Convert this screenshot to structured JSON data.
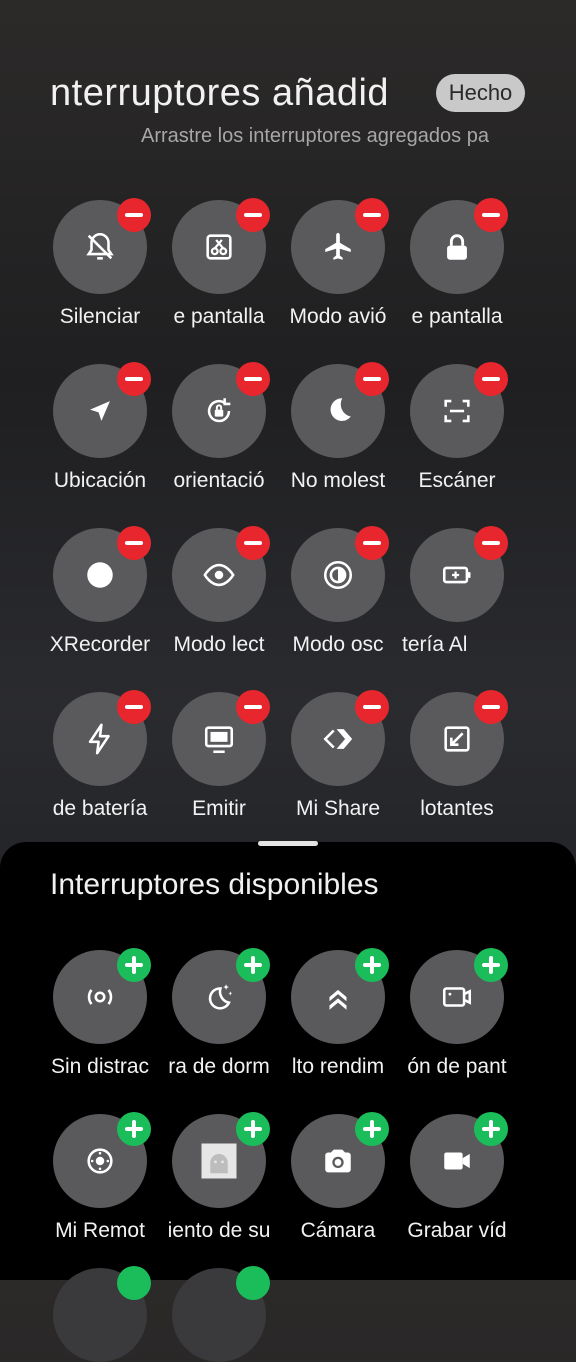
{
  "header": {
    "title": "nterruptores añadid",
    "subtitle": "Arrastre los interruptores agregados pa",
    "done_label": "Hecho"
  },
  "added_toggles": [
    {
      "label": "Silenciar",
      "icon": "bell-off-icon"
    },
    {
      "label": "e pantalla",
      "icon": "screenshot-scissors-icon"
    },
    {
      "label": "Modo avió",
      "icon": "airplane-icon"
    },
    {
      "label": "e pantalla",
      "icon": "lock-icon"
    },
    {
      "label": "Ubicación",
      "icon": "location-arrow-icon"
    },
    {
      "label": "orientació",
      "icon": "rotation-lock-icon"
    },
    {
      "label": "No molest",
      "icon": "moon-icon"
    },
    {
      "label": "Escáner",
      "icon": "scan-frame-icon"
    },
    {
      "label": "XRecorder",
      "icon": "record-dot-icon"
    },
    {
      "label": "Modo lect",
      "icon": "eye-icon"
    },
    {
      "label": "Modo osc",
      "icon": "dark-mode-icon"
    },
    {
      "label": "tería      Al",
      "icon": "battery-saver-icon"
    },
    {
      "label": "de batería",
      "icon": "lightning-icon"
    },
    {
      "label": "Emitir",
      "icon": "cast-monitor-icon"
    },
    {
      "label": "Mi Share",
      "icon": "mi-share-icon"
    },
    {
      "label": "lotantes",
      "icon": "floating-window-icon"
    }
  ],
  "available_title": "Interruptores disponibles",
  "available_toggles": [
    {
      "label": "Sin distrac",
      "icon": "focus-signal-icon"
    },
    {
      "label": "ra de dorm",
      "icon": "bedtime-moon-icon"
    },
    {
      "label": "lto rendim",
      "icon": "chevrons-up-icon"
    },
    {
      "label": "ón de pant",
      "icon": "screen-record-icon"
    },
    {
      "label": "Mi Remot",
      "icon": "remote-icon"
    },
    {
      "label": "iento de su",
      "icon": "android-app-icon"
    },
    {
      "label": "Cámara",
      "icon": "camera-icon"
    },
    {
      "label": "Grabar víd",
      "icon": "video-camera-icon"
    }
  ],
  "colors": {
    "remove_badge": "#e8262d",
    "add_badge": "#1bbd5a",
    "tile": "#5a5a5c"
  }
}
